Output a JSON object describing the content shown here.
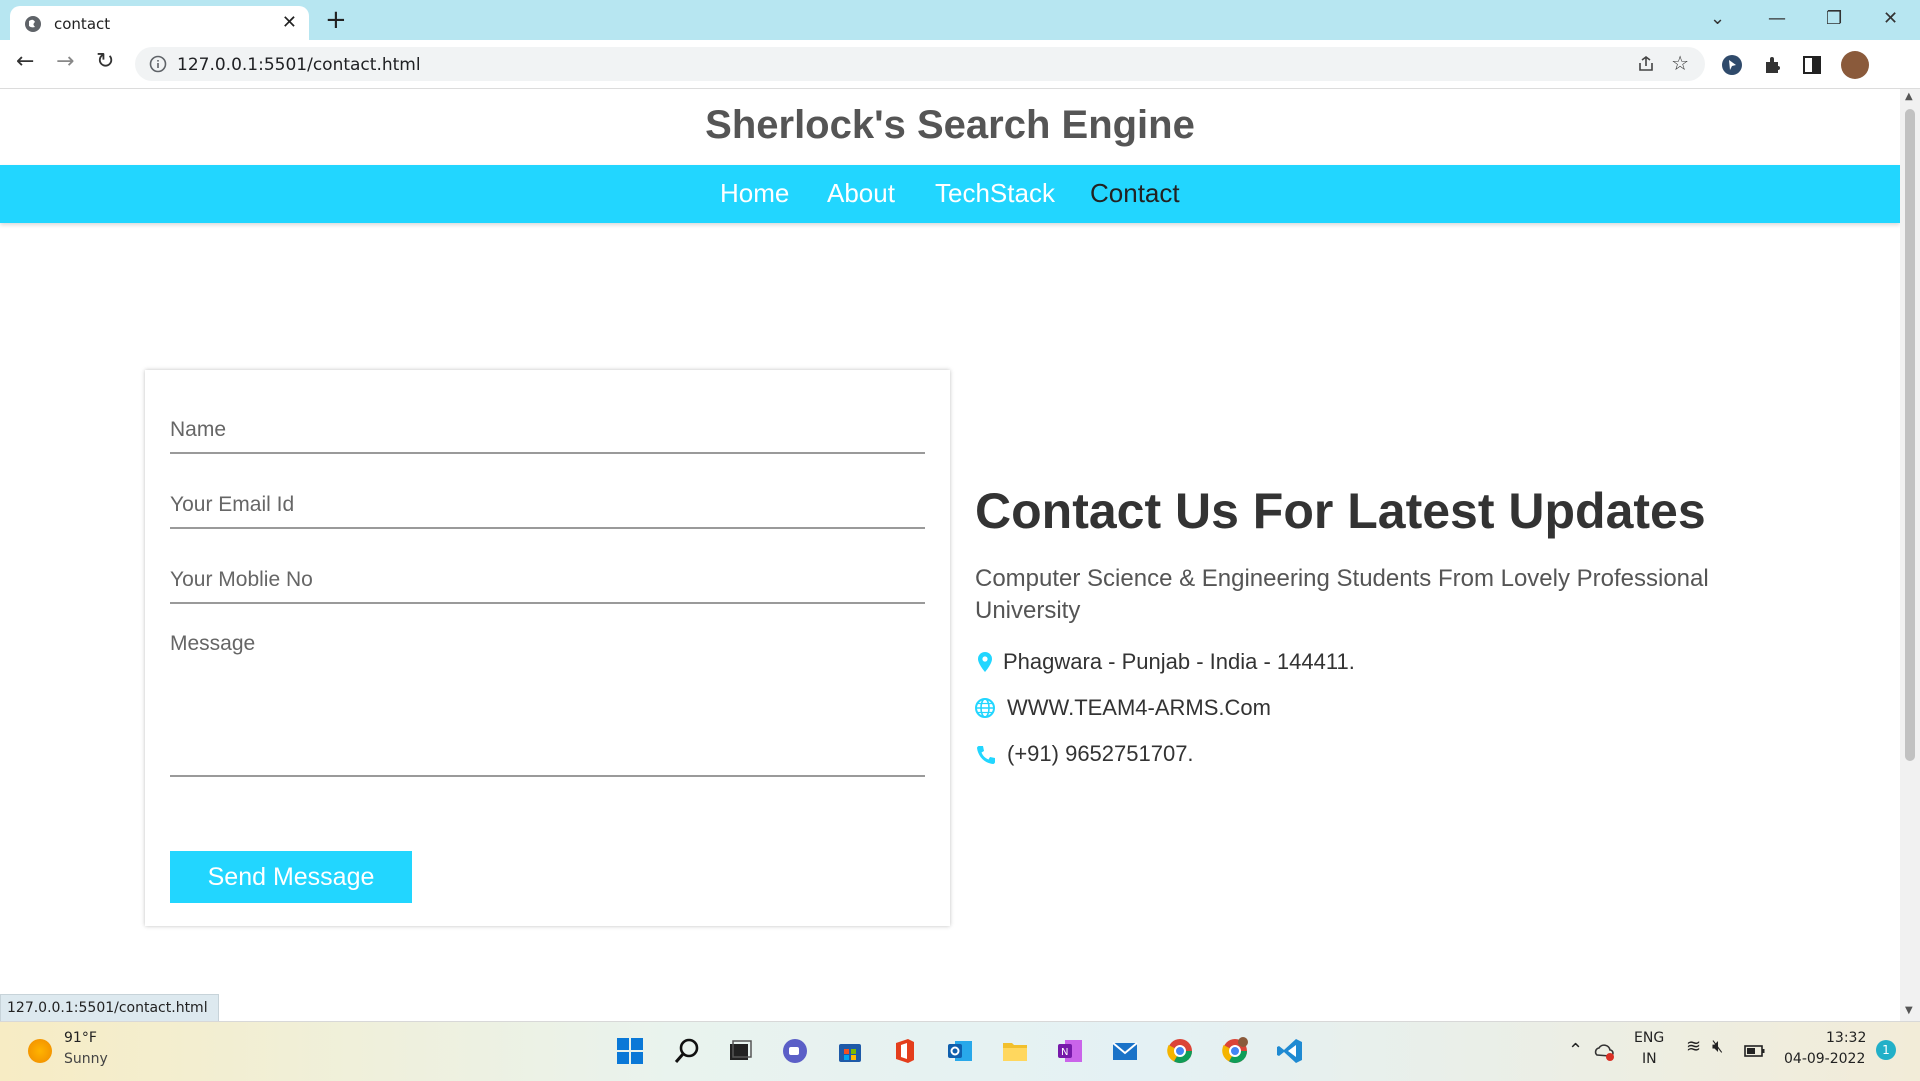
{
  "browser": {
    "tab_title": "contact",
    "url": "127.0.0.1:5501/contact.html",
    "status_url": "127.0.0.1:5501/contact.html"
  },
  "site": {
    "title": "Sherlock's Search Engine",
    "nav": [
      "Home",
      "About",
      "TechStack",
      "Contact"
    ],
    "active_nav": "Contact",
    "accent_color": "#22d6ff"
  },
  "form": {
    "name_placeholder": "Name",
    "email_placeholder": "Your Email Id",
    "mobile_placeholder": "Your Moblie No",
    "message_placeholder": "Message",
    "submit_label": "Send Message"
  },
  "contact": {
    "heading": "Contact Us For Latest Updates",
    "subheading": "Computer Science & Engineering Students From Lovely Professional University",
    "location": "Phagwara - Punjab - India - 144411.",
    "website": "WWW.TEAM4-ARMS.Com",
    "phone": "(+91) 9652751707."
  },
  "taskbar": {
    "weather_temp": "91°F",
    "weather_cond": "Sunny",
    "lang_top": "ENG",
    "lang_bottom": "IN",
    "time": "13:32",
    "date": "04-09-2022",
    "notifications": "1"
  }
}
